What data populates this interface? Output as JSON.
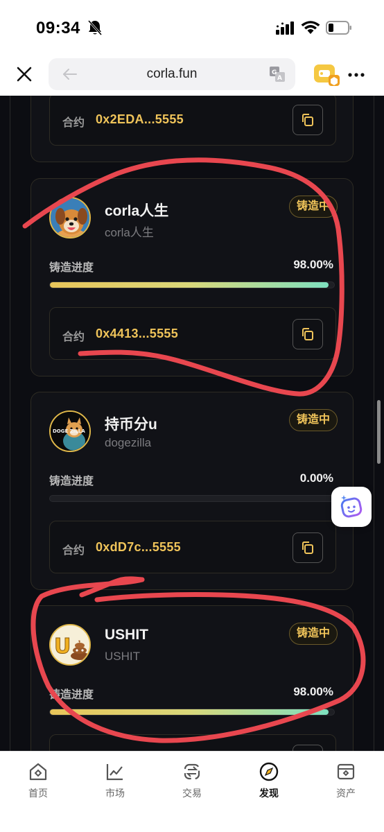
{
  "status": {
    "time": "09:34"
  },
  "browser": {
    "url": "corla.fun"
  },
  "cards": [
    {
      "contract_label": "合约",
      "contract": "0x2EDA...5555"
    },
    {
      "name": "corla人生",
      "sub": "corla人生",
      "badge": "铸造中",
      "progress_label": "铸造进度",
      "progress_text": "98.00%",
      "progress": 0.98,
      "contract_label": "合约",
      "contract": "0x4413...5555"
    },
    {
      "name": "持币分u",
      "sub": "dogezilla",
      "badge": "铸造中",
      "progress_label": "铸造进度",
      "progress_text": "0.00%",
      "progress": 0.0,
      "contract_label": "合约",
      "contract": "0xdD7c...5555"
    },
    {
      "name": "USHIT",
      "sub": "USHIT",
      "badge": "铸造中",
      "progress_label": "铸造进度",
      "progress_text": "98.00%",
      "progress": 0.98
    }
  ],
  "avatars": {
    "dogezilla_text": "DOGE ZILLA",
    "ushit_letter": "U"
  },
  "nav": [
    {
      "label": "首页",
      "icon": "home-icon"
    },
    {
      "label": "市场",
      "icon": "chart-icon"
    },
    {
      "label": "交易",
      "icon": "swap-icon"
    },
    {
      "label": "发现",
      "icon": "compass-icon",
      "active": true
    },
    {
      "label": "资产",
      "icon": "wallet-icon"
    }
  ],
  "colors": {
    "accent": "#f0c45a",
    "annotation": "#e8474f",
    "background": "#0c0d12"
  }
}
